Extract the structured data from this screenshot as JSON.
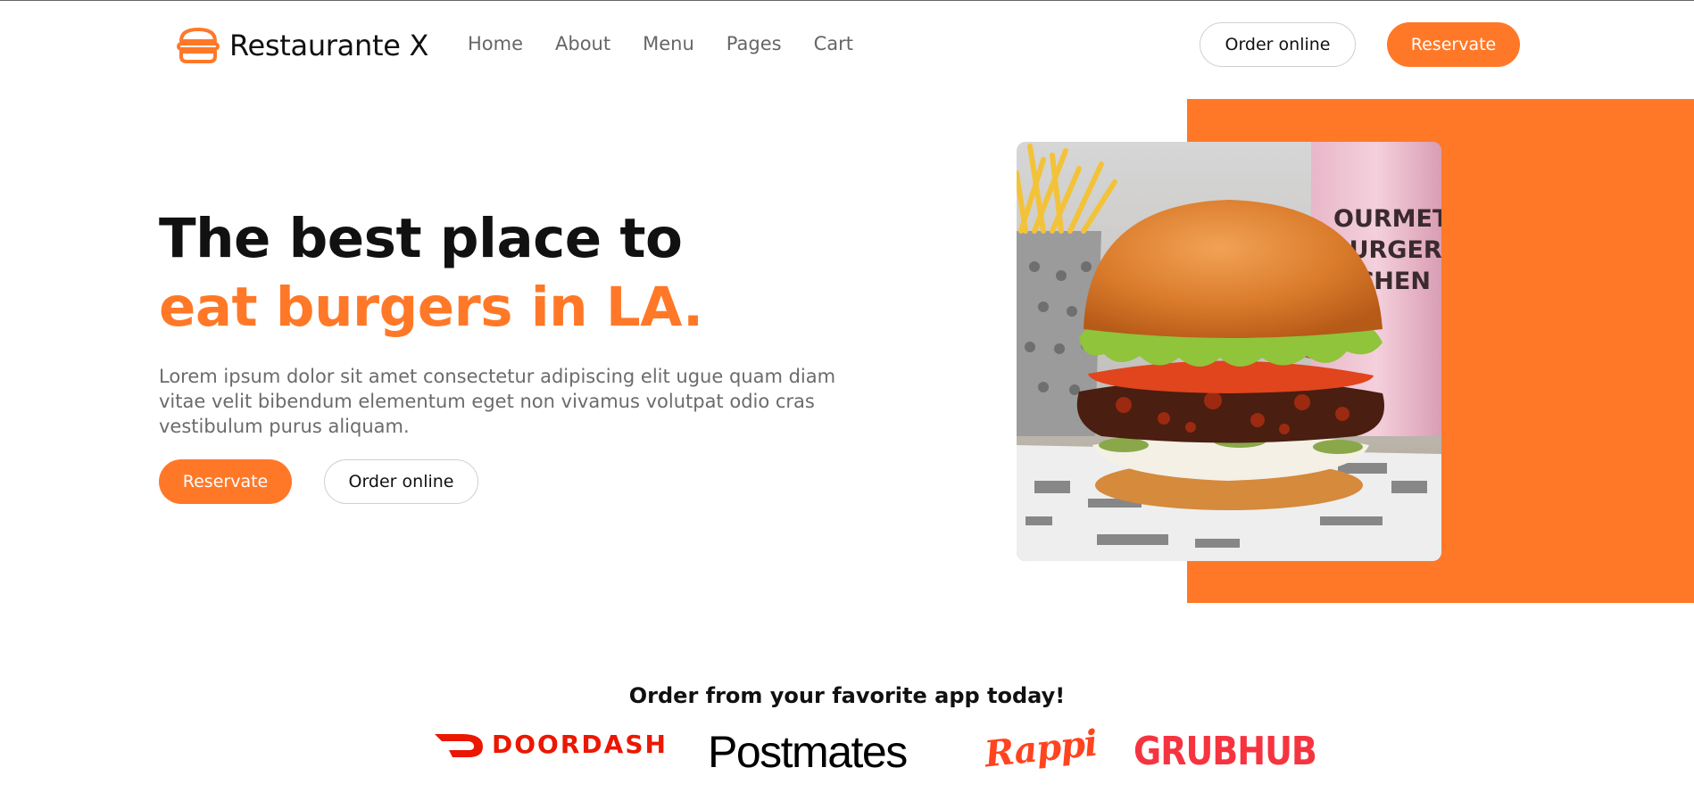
{
  "brand": {
    "name": "Restaurante X",
    "icon": "burger-icon",
    "accent_color": "#FF7828"
  },
  "nav": {
    "items": [
      {
        "label": "Home"
      },
      {
        "label": "About"
      },
      {
        "label": "Menu"
      },
      {
        "label": "Pages"
      },
      {
        "label": "Cart"
      }
    ]
  },
  "header": {
    "order_label": "Order online",
    "reserve_label": "Reservate"
  },
  "hero": {
    "title_line1": "The best place to",
    "title_line2": "eat burgers in LA.",
    "description": "Lorem ipsum dolor sit amet consectetur adipiscing elit ugue quam diam vitae velit bibendum elementum eget non vivamus volutpat odio cras vestibulum purus aliquam.",
    "reserve_label": "Reservate",
    "order_label": "Order online",
    "image": "burger-photo",
    "cup_text": [
      "OURMET",
      "BURGER",
      "ITCHEN"
    ]
  },
  "apps": {
    "title": "Order from your favorite app today!",
    "logos": [
      {
        "name": "DOORDASH",
        "icon": "doordash-logo",
        "color": "#EB1700"
      },
      {
        "name": "Postmates",
        "icon": "postmates-logo",
        "color": "#000000"
      },
      {
        "name": "Rappi",
        "icon": "rappi-logo",
        "color": "#FF441F"
      },
      {
        "name": "GRUBHUB",
        "icon": "grubhub-logo",
        "color": "#F63440"
      }
    ]
  }
}
